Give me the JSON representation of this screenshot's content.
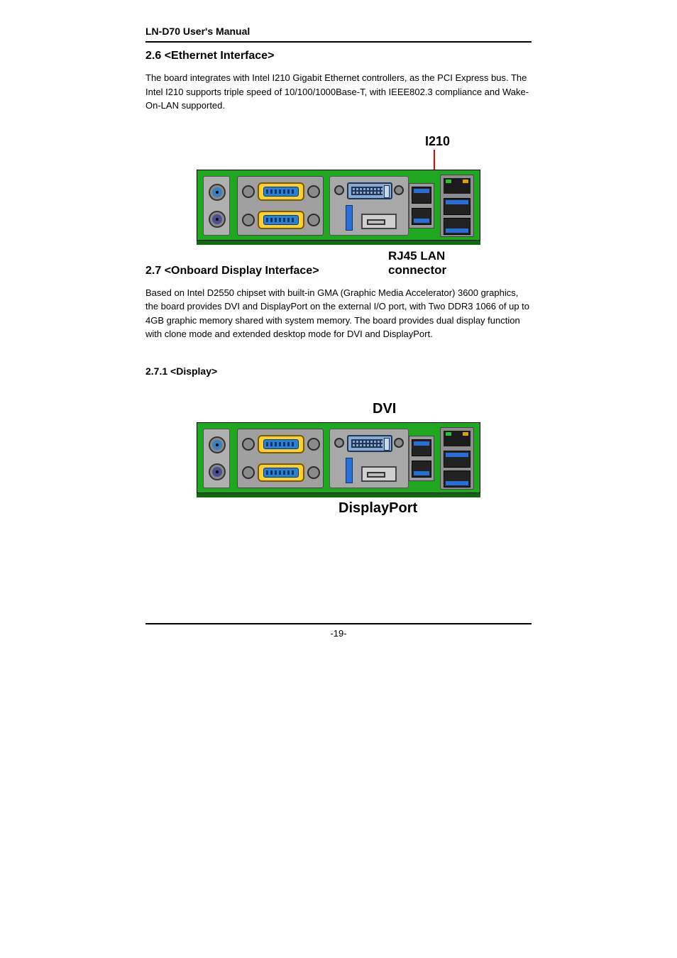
{
  "doc_title": "LN-D70 User's Manual",
  "section_2_6": {
    "heading": "2.6 <Ethernet Interface>",
    "paragraph": "The board integrates with Intel I210 Gigabit Ethernet controllers, as the PCI Express bus. The Intel I210 supports triple speed of 10/100/1000Base-T, with IEEE802.3 compliance and Wake-On-LAN supported.",
    "fig": {
      "callout_chip": "I210",
      "callout_conn": "RJ45 LAN connector"
    }
  },
  "section_2_7": {
    "heading": "2.7 <Onboard Display Interface>",
    "paragraph": "Based on Intel D2550 chipset with built-in GMA (Graphic Media Accelerator) 3600 graphics, the board provides DVI and DisplayPort on the external I/O port, with Two DDR3 1066 of up to 4GB graphic memory shared with system memory. The board provides dual display function with clone mode and extended desktop mode for DVI and DisplayPort.",
    "sub": "2.7.1 <Display>",
    "fig": {
      "callout_dvi": "DVI",
      "callout_dp": "DisplayPort"
    }
  },
  "page_number": "-19-"
}
